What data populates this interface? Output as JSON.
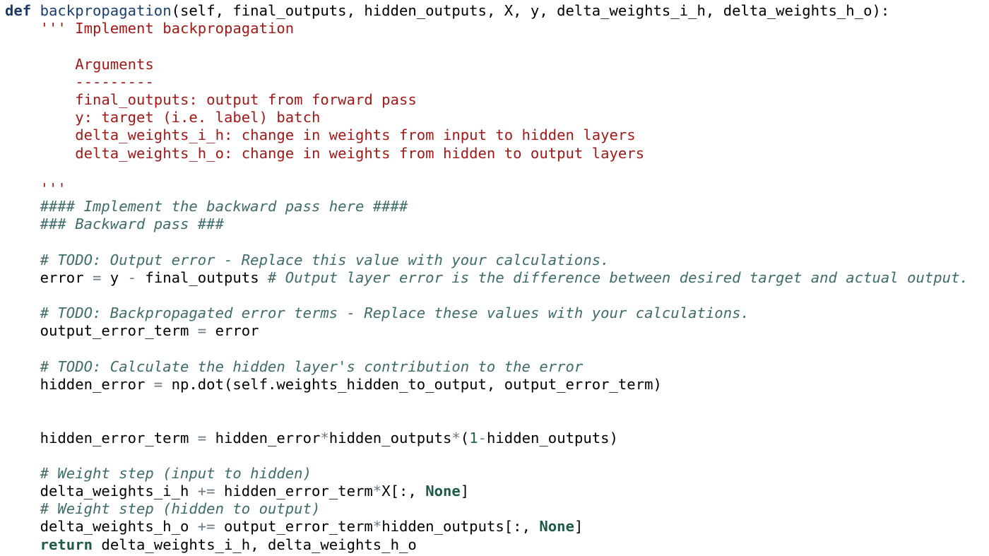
{
  "colors": {
    "background": "#ffffff",
    "keyword": "#1f5a49",
    "def_keyword": "#1b3a66",
    "function_name": "#1c3f6e",
    "string": "#a11a1a",
    "comment": "#3f6b6b",
    "operator": "#6c7a85",
    "number": "#1f6b3a",
    "text": "#000000"
  },
  "code_lines": [
    [
      {
        "t": "def",
        "c": "def"
      },
      {
        "t": " "
      },
      {
        "t": "backpropagation",
        "c": "fn"
      },
      {
        "t": "(self, final_outputs, hidden_outputs, X, y, delta_weights_i_h, delta_weights_h_o):"
      }
    ],
    [
      {
        "t": "    "
      },
      {
        "t": "''' Implement backpropagation",
        "c": "str"
      }
    ],
    [],
    [
      {
        "t": "        "
      },
      {
        "t": "Arguments",
        "c": "str"
      }
    ],
    [
      {
        "t": "        "
      },
      {
        "t": "---------",
        "c": "str"
      }
    ],
    [
      {
        "t": "        "
      },
      {
        "t": "final_outputs: output from forward pass",
        "c": "str"
      }
    ],
    [
      {
        "t": "        "
      },
      {
        "t": "y: target (i.e. label) batch",
        "c": "str"
      }
    ],
    [
      {
        "t": "        "
      },
      {
        "t": "delta_weights_i_h: change in weights from input to hidden layers",
        "c": "str"
      }
    ],
    [
      {
        "t": "        "
      },
      {
        "t": "delta_weights_h_o: change in weights from hidden to output layers",
        "c": "str"
      }
    ],
    [],
    [
      {
        "t": "    "
      },
      {
        "t": "'''",
        "c": "str"
      }
    ],
    [
      {
        "t": "    "
      },
      {
        "t": "#### Implement the backward pass here ####",
        "c": "com"
      }
    ],
    [
      {
        "t": "    "
      },
      {
        "t": "### Backward pass ###",
        "c": "com"
      }
    ],
    [],
    [
      {
        "t": "    "
      },
      {
        "t": "# TODO: Output error - Replace this value with your calculations.",
        "c": "com"
      }
    ],
    [
      {
        "t": "    error "
      },
      {
        "t": "=",
        "c": "op"
      },
      {
        "t": " y "
      },
      {
        "t": "-",
        "c": "op"
      },
      {
        "t": " final_outputs "
      },
      {
        "t": "# Output layer error is the difference between desired target and actual output.",
        "c": "com"
      }
    ],
    [],
    [
      {
        "t": "    "
      },
      {
        "t": "# TODO: Backpropagated error terms - Replace these values with your calculations.",
        "c": "com"
      }
    ],
    [
      {
        "t": "    output_error_term "
      },
      {
        "t": "=",
        "c": "op"
      },
      {
        "t": " error"
      }
    ],
    [],
    [
      {
        "t": "    "
      },
      {
        "t": "# TODO: Calculate the hidden layer's contribution to the error",
        "c": "com"
      }
    ],
    [
      {
        "t": "    hidden_error "
      },
      {
        "t": "=",
        "c": "op"
      },
      {
        "t": " np.dot(self.weights_hidden_to_output, output_error_term)"
      }
    ],
    [],
    [],
    [
      {
        "t": "    hidden_error_term "
      },
      {
        "t": "=",
        "c": "op"
      },
      {
        "t": " hidden_error"
      },
      {
        "t": "*",
        "c": "op"
      },
      {
        "t": "hidden_outputs"
      },
      {
        "t": "*",
        "c": "op"
      },
      {
        "t": "("
      },
      {
        "t": "1",
        "c": "num"
      },
      {
        "t": "-",
        "c": "op"
      },
      {
        "t": "hidden_outputs)"
      }
    ],
    [],
    [
      {
        "t": "    "
      },
      {
        "t": "# Weight step (input to hidden)",
        "c": "com"
      }
    ],
    [
      {
        "t": "    delta_weights_i_h "
      },
      {
        "t": "+=",
        "c": "op"
      },
      {
        "t": " hidden_error_term"
      },
      {
        "t": "*",
        "c": "op"
      },
      {
        "t": "X[:, "
      },
      {
        "t": "None",
        "c": "kw"
      },
      {
        "t": "]"
      }
    ],
    [
      {
        "t": "    "
      },
      {
        "t": "# Weight step (hidden to output)",
        "c": "com"
      }
    ],
    [
      {
        "t": "    delta_weights_h_o "
      },
      {
        "t": "+=",
        "c": "op"
      },
      {
        "t": " output_error_term"
      },
      {
        "t": "*",
        "c": "op"
      },
      {
        "t": "hidden_outputs[:, "
      },
      {
        "t": "None",
        "c": "kw"
      },
      {
        "t": "]"
      }
    ],
    [
      {
        "t": "    "
      },
      {
        "t": "return",
        "c": "kw"
      },
      {
        "t": " delta_weights_i_h, delta_weights_h_o"
      }
    ]
  ]
}
